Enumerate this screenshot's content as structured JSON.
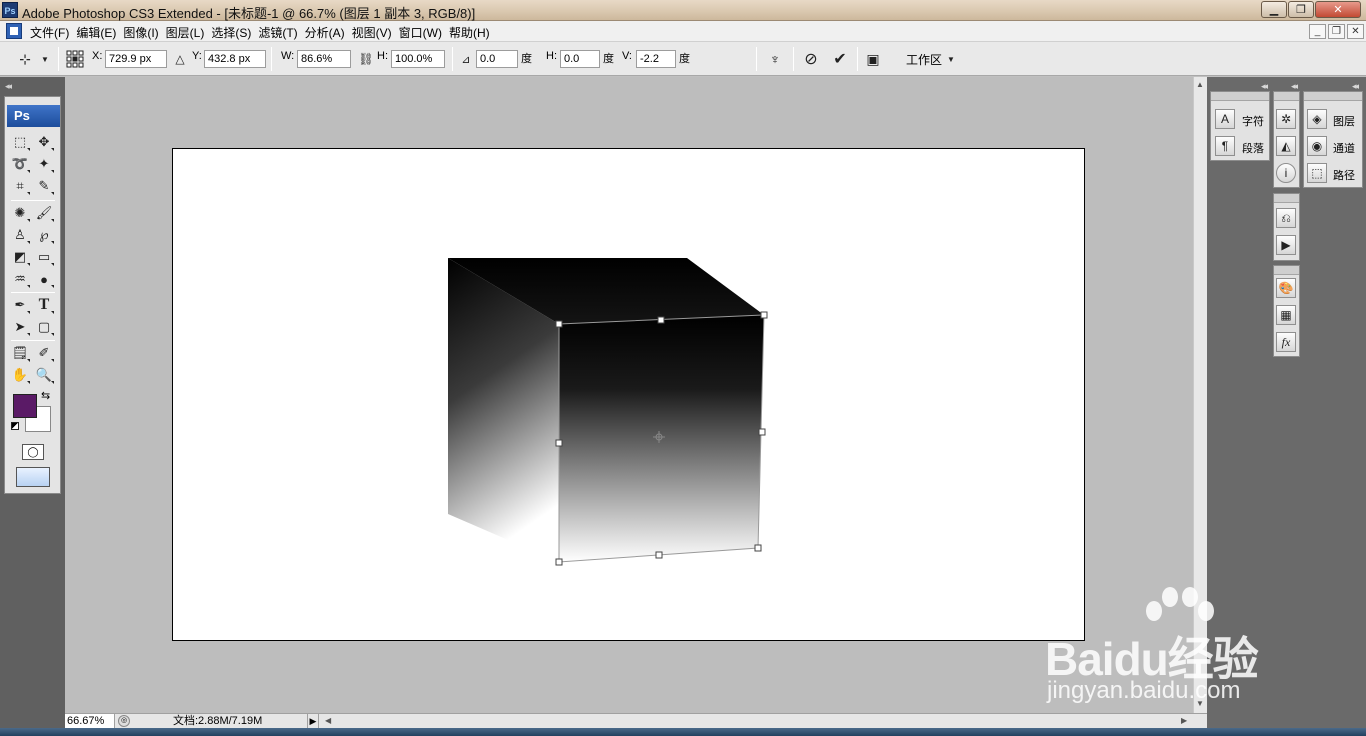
{
  "window": {
    "title": "Adobe Photoshop CS3 Extended - [未标题-1 @ 66.7% (图层 1 副本 3, RGB/8)]",
    "app_icon": "Ps"
  },
  "menu": {
    "items": [
      "文件(F)",
      "编辑(E)",
      "图像(I)",
      "图层(L)",
      "选择(S)",
      "滤镜(T)",
      "分析(A)",
      "视图(V)",
      "窗口(W)",
      "帮助(H)"
    ]
  },
  "options": {
    "x_label": "X:",
    "x_value": "729.9 px",
    "y_label": "Y:",
    "y_value": "432.8 px",
    "w_label": "W:",
    "w_value": "86.6%",
    "h_label": "H:",
    "h_value": "100.0%",
    "rotate_value": "0.0",
    "rotate_unit": "度",
    "skew_h_label": "H:",
    "skew_h_value": "0.0",
    "skew_h_unit": "度",
    "skew_v_label": "V:",
    "skew_v_value": "-2.2",
    "skew_v_unit": "度",
    "workspace_label": "工作区"
  },
  "toolbox": {
    "logo": "Ps",
    "foreground_color": "#5a1a66",
    "background_color": "#ffffff"
  },
  "panels": {
    "character_label": "字符",
    "paragraph_label": "段落",
    "layers_label": "图层",
    "channels_label": "通道",
    "paths_label": "路径"
  },
  "status": {
    "zoom": "66.67%",
    "doc_info": "文档:2.88M/7.19M"
  },
  "watermark": {
    "brand": "Baidu经验",
    "url": "jingyan.baidu.com"
  }
}
